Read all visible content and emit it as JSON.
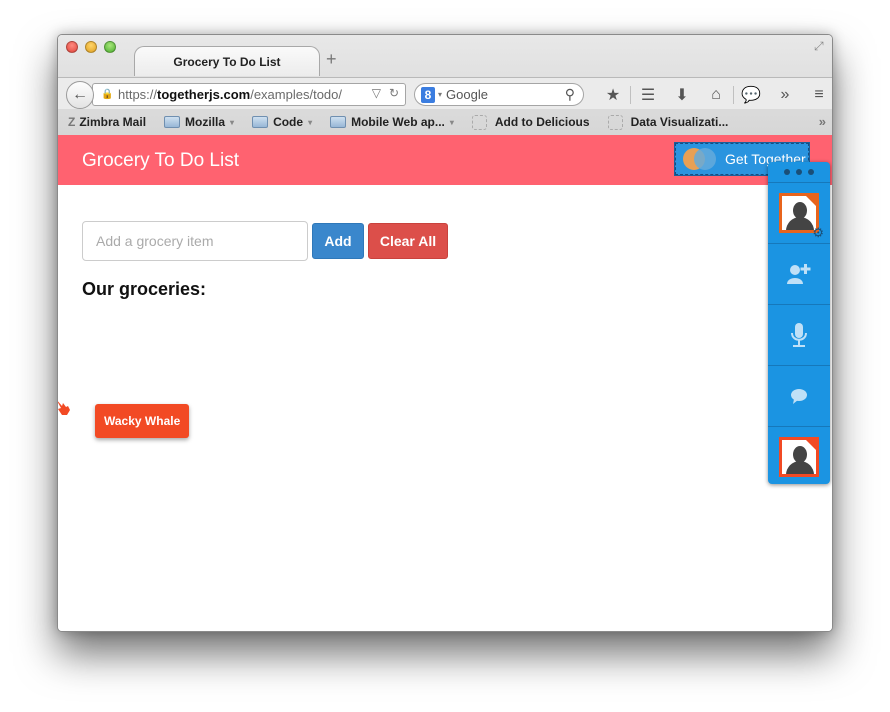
{
  "browser": {
    "window_controls": [
      "close",
      "minimize",
      "zoom"
    ],
    "active_tab": {
      "title": "Grocery To Do List"
    },
    "new_tab_label": "+",
    "url": {
      "scheme": "https://",
      "domain": "togetherjs.com",
      "path": "/examples/todo/"
    },
    "search": {
      "engine_badge": "8",
      "placeholder": "Google"
    },
    "toolbar_icons": [
      "bookmark-star-icon",
      "bookmarks-list-icon",
      "downloads-icon",
      "home-icon",
      "together-chat-icon",
      "overflow-chevron-icon",
      "menu-icon"
    ],
    "toolbar_glyphs": {
      "star": "★",
      "list": "☰",
      "download": "⬇",
      "home": "⌂",
      "chat": "💬",
      "overflow": "»",
      "menu": "≡",
      "back": "←",
      "lock": "🔒",
      "dropmarker": "▽",
      "reload": "↻",
      "search": "⚲",
      "fullscreen": "⤢"
    },
    "bookmarks": [
      {
        "label": "Zimbra Mail",
        "type": "zimbra",
        "icon_glyph": "Z"
      },
      {
        "label": "Mozilla",
        "type": "folder",
        "caret": "▾"
      },
      {
        "label": "Code",
        "type": "folder",
        "caret": "▾"
      },
      {
        "label": "Mobile Web ap...",
        "type": "folder",
        "caret": "▾"
      },
      {
        "label": "Add to Delicious",
        "type": "bookmark"
      },
      {
        "label": "Data Visualizati...",
        "type": "bookmark"
      }
    ],
    "bookmarks_overflow": "»"
  },
  "app": {
    "title": "Grocery To Do List",
    "header_color": "#ff6270",
    "get_together_label": "Get Together",
    "input": {
      "value": "",
      "placeholder": "Add a grocery item"
    },
    "add_button": "Add",
    "clear_button": "Clear All",
    "list_heading": "Our groceries:",
    "items": []
  },
  "collaboration": {
    "remote_cursor": {
      "name": "Wacky Whale",
      "color": "#f24a24"
    },
    "dock": {
      "grip_dots": 3,
      "self_color": "#e8641c",
      "peer_color": "#f24a24",
      "buttons": [
        {
          "name": "invite",
          "glyph": "👤+"
        },
        {
          "name": "audio",
          "glyph": "🎤"
        },
        {
          "name": "chat",
          "glyph": "💬"
        }
      ],
      "settings_glyph": "⚙",
      "dock_color": "#1b94e2"
    }
  }
}
